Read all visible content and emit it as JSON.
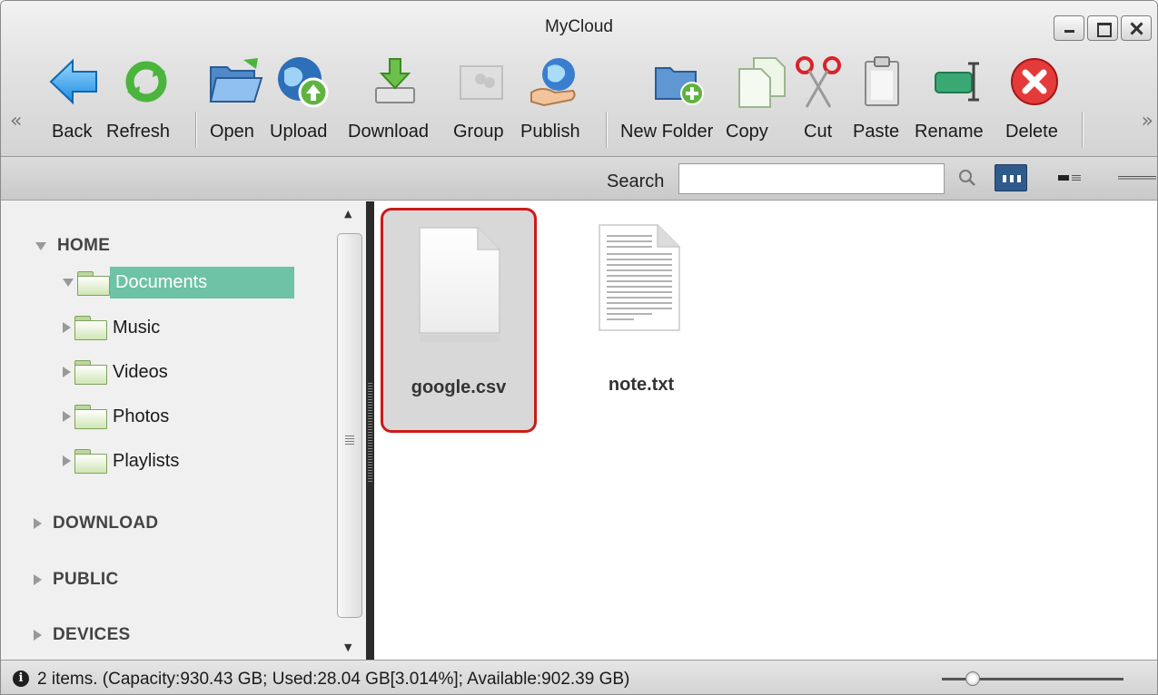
{
  "window": {
    "title": "MyCloud"
  },
  "toolbar": {
    "items": [
      {
        "label": "Back",
        "icon": "back-arrow-icon"
      },
      {
        "label": "Refresh",
        "icon": "refresh-icon"
      },
      {
        "label": "Open",
        "icon": "open-folder-icon"
      },
      {
        "label": "Upload",
        "icon": "upload-globe-icon"
      },
      {
        "label": "Download",
        "icon": "download-icon"
      },
      {
        "label": "Group",
        "icon": "group-icon"
      },
      {
        "label": "Publish",
        "icon": "publish-icon"
      },
      {
        "label": "New Folder",
        "icon": "new-folder-icon"
      },
      {
        "label": "Copy",
        "icon": "copy-icon"
      },
      {
        "label": "Cut",
        "icon": "scissors-icon"
      },
      {
        "label": "Paste",
        "icon": "paste-icon"
      },
      {
        "label": "Rename",
        "icon": "rename-icon"
      },
      {
        "label": "Delete",
        "icon": "delete-icon"
      }
    ],
    "scroll_left": "«",
    "scroll_right": "»"
  },
  "search": {
    "label": "Search",
    "value": "",
    "placeholder": ""
  },
  "tree": {
    "home": "HOME",
    "folders": [
      "Documents",
      "Music",
      "Videos",
      "Photos",
      "Playlists"
    ],
    "selected": "Documents",
    "download": "DOWNLOAD",
    "public": "PUBLIC",
    "devices": "DEVICES"
  },
  "files": [
    {
      "name": "google.csv",
      "type": "blank-file",
      "selected": true
    },
    {
      "name": "note.txt",
      "type": "text-file",
      "selected": false
    }
  ],
  "status": {
    "text": "2 items. (Capacity:930.43 GB; Used:28.04 GB[3.014%]; Available:902.39 GB)",
    "zoom_level": 0.17
  },
  "colors": {
    "selection": "#6ec2a6",
    "selected_file_border": "#cc1a1a",
    "view_button_active": "#2f5a8c"
  }
}
